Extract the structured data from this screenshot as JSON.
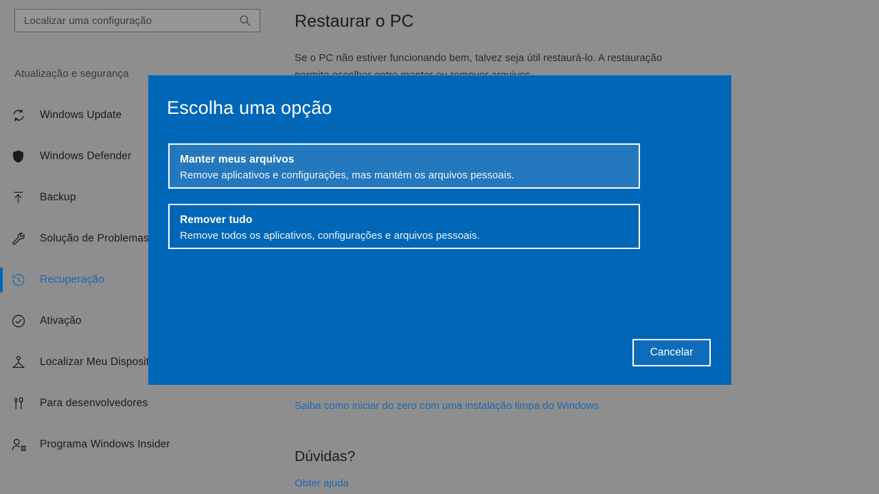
{
  "colors": {
    "dialog_blue": "#0067B8",
    "option_hover_blue": "#2478BD",
    "accent_blue": "#1B68B0",
    "dimmed_background": "#8E8E8E"
  },
  "search": {
    "placeholder": "Localizar uma configuração",
    "value": "Localizar uma configuração",
    "icon": "search-icon"
  },
  "sidebar": {
    "category": "Atualização e segurança",
    "items": [
      {
        "label": "Windows Update",
        "icon": "sync-icon",
        "selected": false
      },
      {
        "label": "Windows Defender",
        "icon": "shield-icon",
        "selected": false
      },
      {
        "label": "Backup",
        "icon": "upload-arrow-icon",
        "selected": false
      },
      {
        "label": "Solução de Problemas",
        "icon": "wrench-icon",
        "selected": false
      },
      {
        "label": "Recuperação",
        "icon": "history-clock-icon",
        "selected": true
      },
      {
        "label": "Ativação",
        "icon": "check-circle-icon",
        "selected": false
      },
      {
        "label": "Localizar Meu Dispositivo",
        "icon": "location-pin-icon",
        "selected": false
      },
      {
        "label": "Para desenvolvedores",
        "icon": "tools-icon",
        "selected": false
      },
      {
        "label": "Programa Windows Insider",
        "icon": "person-badge-icon",
        "selected": false
      }
    ]
  },
  "content": {
    "title": "Restaurar o PC",
    "description": "Se o PC não estiver funcionando bem, talvez seja útil restaurá-lo. A restauração permite escolher entre manter ou remover arquivos.",
    "clean_install_link": "Saiba como iniciar do zero com uma instalação limpa do Windows",
    "questions_heading": "Dúvidas?",
    "help_link": "Obter ajuda"
  },
  "dialog": {
    "title": "Escolha uma opção",
    "options": [
      {
        "title": "Manter meus arquivos",
        "description": "Remove aplicativos e configurações, mas mantém os arquivos pessoais.",
        "highlighted": true
      },
      {
        "title": "Remover tudo",
        "description": "Remove todos os aplicativos, configurações e arquivos pessoais.",
        "highlighted": false
      }
    ],
    "cancel_label": "Cancelar"
  }
}
